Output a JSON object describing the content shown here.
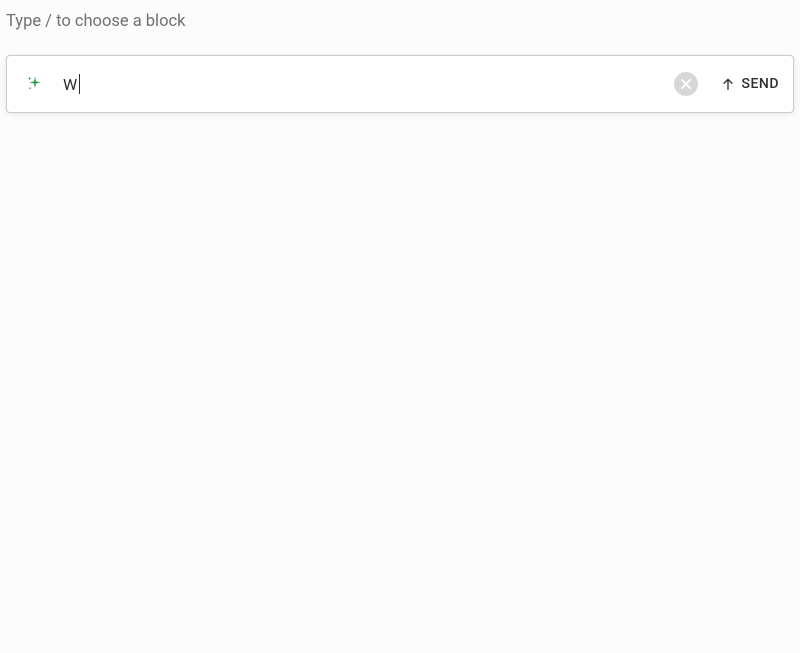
{
  "placeholder_above": "Type / to choose a block",
  "prompt": {
    "input_value": "W",
    "send_label": "SEND"
  },
  "icons": {
    "sparkle": "sparkle-icon",
    "clear": "close-icon",
    "send_arrow": "arrow-up-icon"
  },
  "colors": {
    "accent_green": "#2a9d3f",
    "muted_text": "#6e7074",
    "circle_bg": "#d6d7d8",
    "circle_x": "#ffffff"
  }
}
